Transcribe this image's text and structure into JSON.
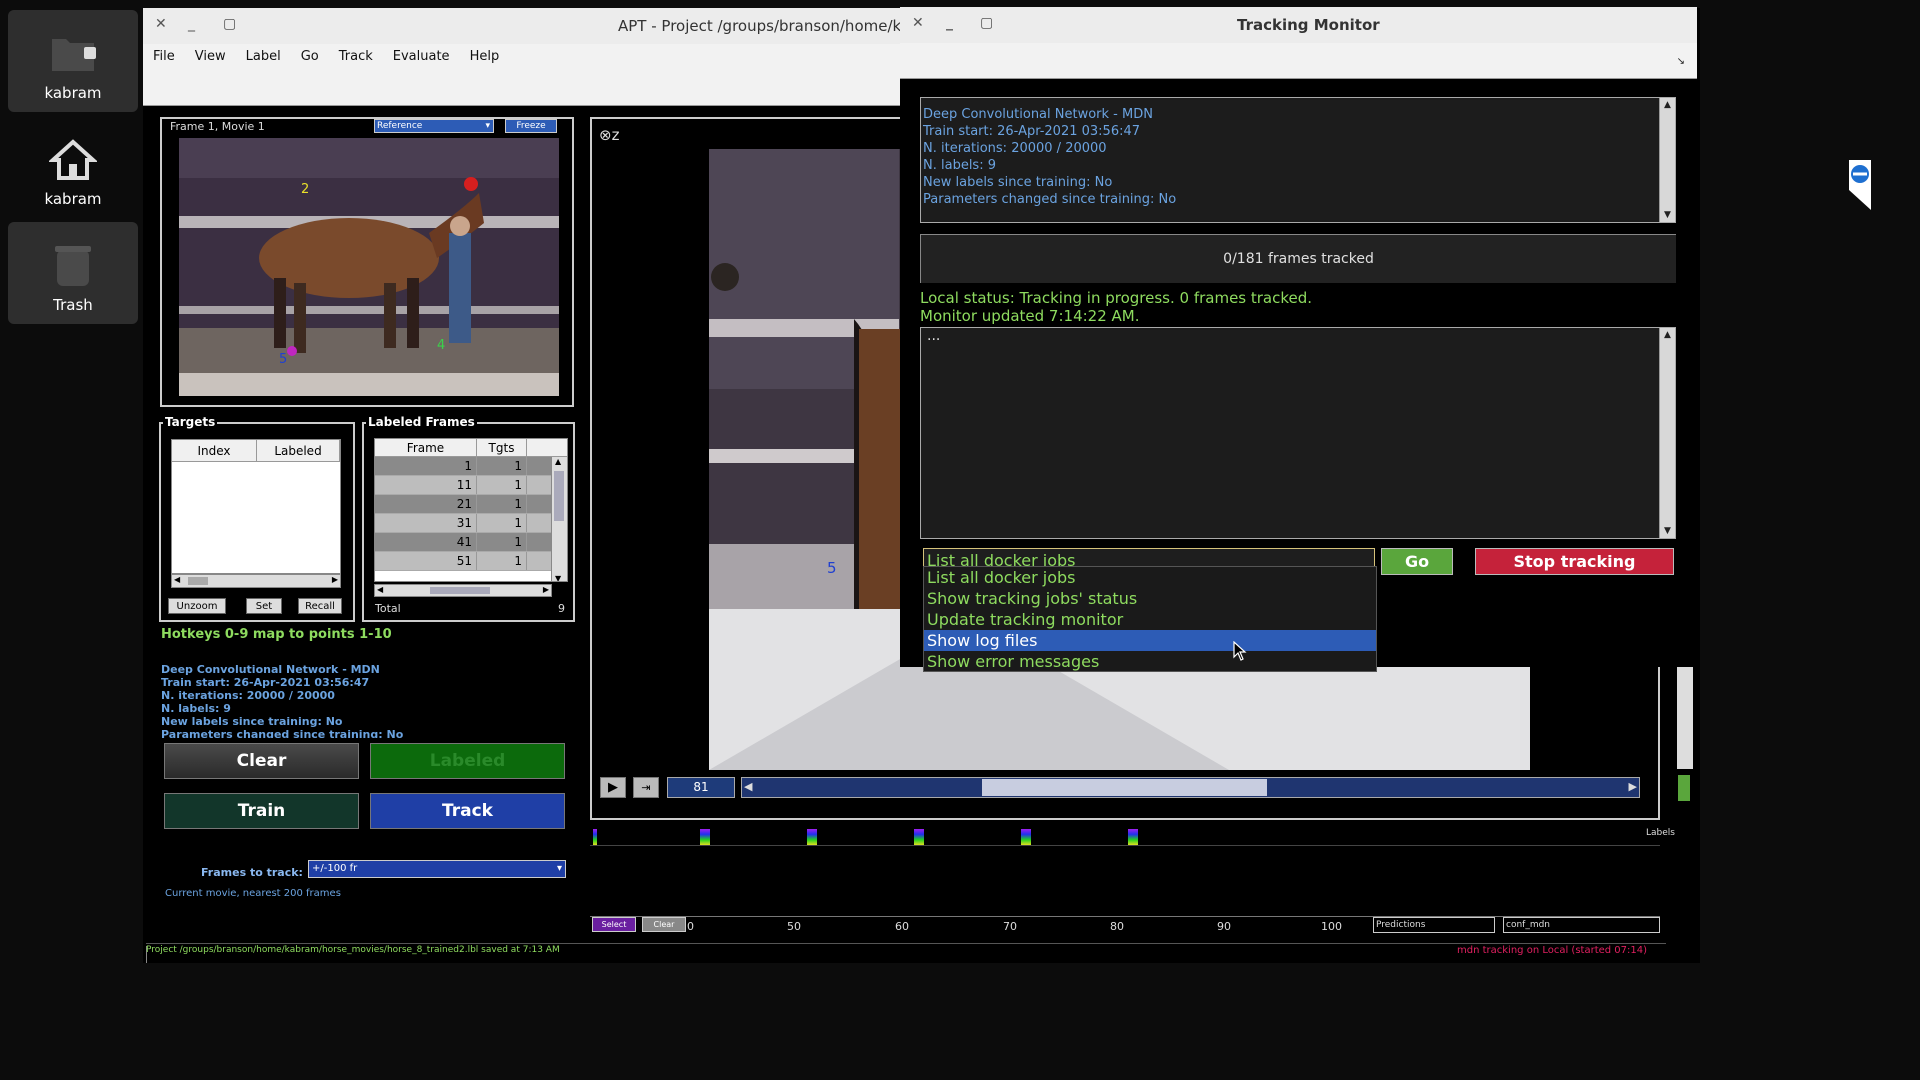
{
  "desktop": {
    "icons": [
      {
        "label": "kabram"
      },
      {
        "label": "kabram"
      },
      {
        "label": "Trash"
      }
    ]
  },
  "apt": {
    "title": "APT - Project /groups/branson/home/ka",
    "menu": [
      "File",
      "View",
      "Label",
      "Go",
      "Track",
      "Evaluate",
      "Help"
    ],
    "frame_label": "Frame 1, Movie 1",
    "reference_select": "Reference",
    "freeze_button": "Freeze",
    "targets": {
      "title": "Targets",
      "columns": [
        "Index",
        "Labeled"
      ],
      "buttons": [
        "Unzoom",
        "Set",
        "Recall"
      ]
    },
    "labeled_frames": {
      "title": "Labeled Frames",
      "columns": [
        "Frame",
        "Tgts"
      ],
      "rows": [
        {
          "frame": "1",
          "tgts": "1"
        },
        {
          "frame": "11",
          "tgts": "1"
        },
        {
          "frame": "21",
          "tgts": "1"
        },
        {
          "frame": "31",
          "tgts": "1"
        },
        {
          "frame": "41",
          "tgts": "1"
        },
        {
          "frame": "51",
          "tgts": "1"
        }
      ],
      "total_label": "Total",
      "total_value": "9"
    },
    "hotkeys": "Hotkeys 0-9 map to points 1-10",
    "info_lines": [
      "Deep Convolutional Network - MDN",
      "Train start: 26-Apr-2021 03:56:47",
      "N. iterations: 20000 / 20000",
      "N. labels: 9",
      "New labels since training: No",
      "Parameters changed since training: No"
    ],
    "buttons": {
      "clear": "Clear",
      "labeled": "Labeled",
      "train": "Train",
      "track": "Track"
    },
    "frames_to_track_label": "Frames to track:",
    "frames_to_track_value": "+/-100 fr",
    "frames_note": "Current movie, nearest 200 frames",
    "frame_number": "81",
    "timeline_ticks": [
      "0",
      "50",
      "60",
      "70",
      "80",
      "90",
      "100"
    ],
    "labels_text": "Labels",
    "select_button": "Select",
    "clear_small_button": "Clear",
    "predictions_select": "Predictions",
    "conf_select": "conf_mdn",
    "status_left": "Project /groups/branson/home/kabram/horse_movies/horse_8_trained2.lbl saved at  7:13 AM",
    "status_right": "mdn tracking on Local (started 07:14)",
    "point_labels": [
      "2",
      "5",
      "4",
      "5"
    ],
    "colors": {
      "green_text": "#8edb5f",
      "blue_text": "#6ba3e0",
      "track_blue": "#1f3fa6",
      "train_green": "#12362a",
      "labeled_green": "#0c6a0c"
    }
  },
  "tracking_monitor": {
    "title": "Tracking Monitor",
    "info_lines": [
      "Deep Convolutional Network - MDN",
      "Train start: 26-Apr-2021 03:56:47",
      "N. iterations: 20000 / 20000",
      "N. labels: 9",
      "New labels since training: No",
      "Parameters changed since training: No"
    ],
    "frames_tracked": "0/181 frames tracked",
    "status_line1": "Local status: Tracking in progress. 0 frames tracked.",
    "status_line2": "Monitor updated  7:14:22 AM.",
    "log_text": "...",
    "select_value": "List all docker jobs",
    "go_button": "Go",
    "stop_button": "Stop tracking",
    "options": [
      "List all docker jobs",
      "Show tracking jobs' status",
      "Update tracking monitor",
      "Show log files",
      "Show error messages"
    ],
    "selected_option_index": 3
  }
}
